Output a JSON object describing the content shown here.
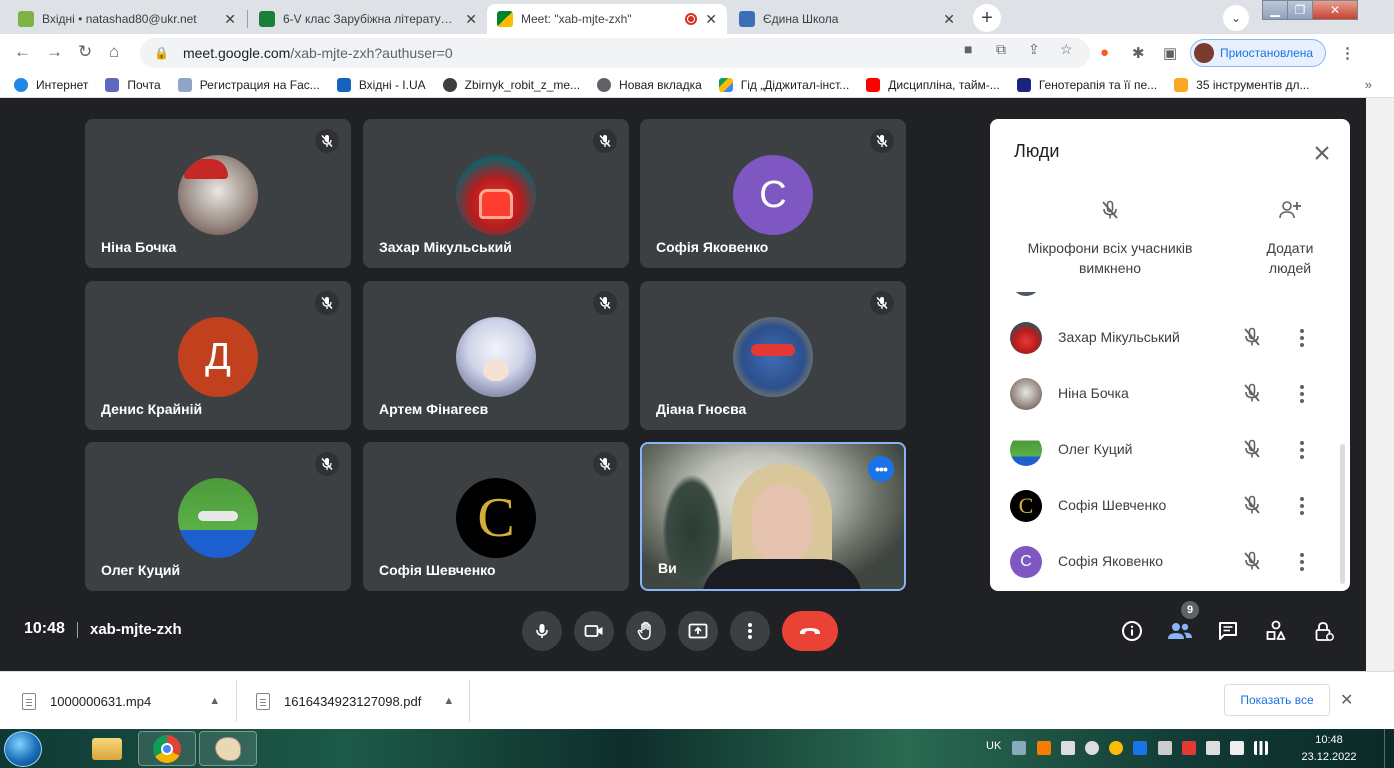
{
  "browser": {
    "tabs": [
      {
        "title": "Вхідні • natashad80@ukr.net",
        "favicon_color": "#7cb342"
      },
      {
        "title": "6-V клас Зарубіжна література 2",
        "favicon_color": "#188038"
      },
      {
        "title": "Meet: \"xab-mjte-zxh\"",
        "favicon_color": "#00897b"
      },
      {
        "title": "Єдина Школа",
        "favicon_color": "#3b6fb6"
      }
    ],
    "new_tab": "+",
    "url_host": "meet.google.com",
    "url_path": "/xab-mjte-zxh?authuser=0",
    "profile_label": "Приостановлена",
    "bookmarks": [
      {
        "label": "Интернет",
        "color": "#1e88e5"
      },
      {
        "label": "Почта",
        "color": "#5c6bc0"
      },
      {
        "label": "Регистрация на Fac...",
        "color": "#90a4c8"
      },
      {
        "label": "Вхідні - I.UA",
        "color": "#1565c0"
      },
      {
        "label": "Zbirnyk_robit_z_me...",
        "color": "#3c4043"
      },
      {
        "label": "Новая вкладка",
        "color": "#5f6368"
      },
      {
        "label": "Гід „Діджитал-інст...",
        "color": "#fbbc04"
      },
      {
        "label": "Дисципліна, тайм-...",
        "color": "#ff0000"
      },
      {
        "label": "Генотерапія та її пе...",
        "color": "#1a237e"
      },
      {
        "label": "35 інструментів дл...",
        "color": "#f9a825"
      }
    ],
    "bookmarks_more": "»"
  },
  "meet": {
    "tiles": [
      {
        "name": "Ніна Бочка",
        "initial": "",
        "color": "#5a3a36"
      },
      {
        "name": "Захар Мікульський",
        "initial": "",
        "color": "#e53935"
      },
      {
        "name": "Софія Яковенко",
        "initial": "C",
        "color": "#7e57c2"
      },
      {
        "name": "Денис Крайній",
        "initial": "Д",
        "color": "#c1401d"
      },
      {
        "name": "Артем Фінагеєв",
        "initial": "",
        "color": "#b8bcd6"
      },
      {
        "name": "Діана Гноєва",
        "initial": "",
        "color": "#2d4f8c"
      },
      {
        "name": "Олег Куций",
        "initial": "",
        "color": "#4c9a3b"
      },
      {
        "name": "Софія Шевченко",
        "initial": "C",
        "color": "#000000"
      },
      {
        "name": "Ви",
        "initial": "",
        "color": "#6b6f68"
      }
    ],
    "time": "10:48",
    "meeting_code": "xab-mjte-zxh",
    "people_count": "9",
    "leave_color": "#ea4335",
    "accent": "#1a73e8"
  },
  "people_panel": {
    "title": "Люди",
    "mute_all": "Мікрофони всіх учасників вимкнено",
    "add_people": "Додати людей",
    "participants": [
      {
        "name": "Захар Мікульський",
        "initial": "",
        "color": "#e53935"
      },
      {
        "name": "Ніна Бочка",
        "initial": "",
        "color": "#5a3a36"
      },
      {
        "name": "Олег Куций",
        "initial": "",
        "color": "#4c9a3b"
      },
      {
        "name": "Софія Шевченко",
        "initial": "C",
        "color": "#000000"
      },
      {
        "name": "Софія Яковенко",
        "initial": "C",
        "color": "#7e57c2"
      }
    ]
  },
  "downloads": {
    "items": [
      {
        "name": "1000000631.mp4"
      },
      {
        "name": "1616434923127098.pdf"
      }
    ],
    "show_all": "Показать все"
  },
  "taskbar": {
    "lang": "UK",
    "time": "10:48",
    "date": "23.12.2022"
  }
}
